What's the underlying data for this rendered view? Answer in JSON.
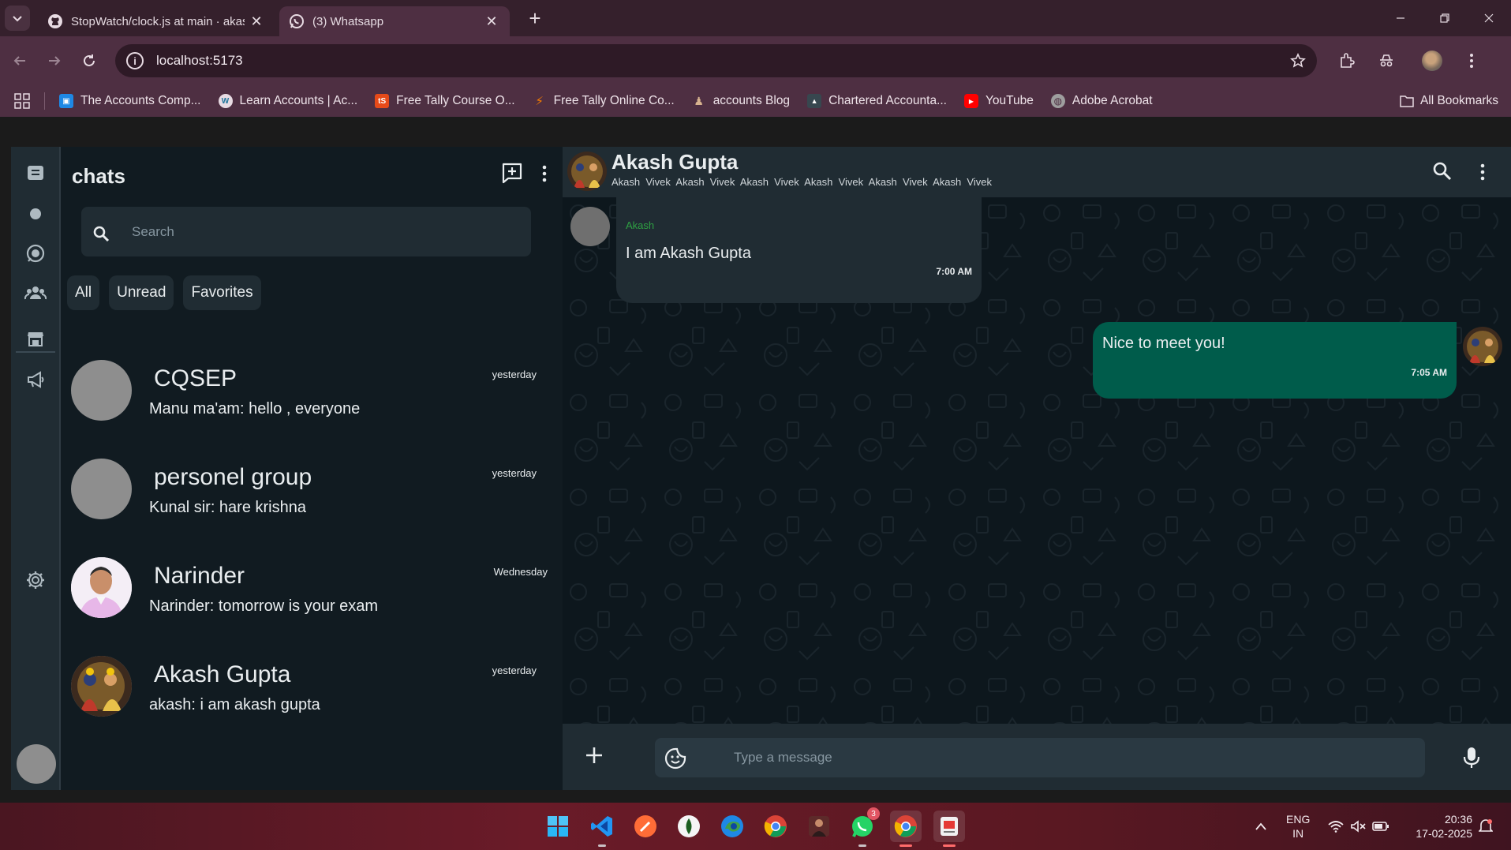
{
  "browser": {
    "tabs": [
      {
        "title": "StopWatch/clock.js at main · akash",
        "favicon": "github-icon",
        "active": false
      },
      {
        "title": "(3) Whatsapp",
        "favicon": "whatsapp-icon",
        "active": true
      }
    ],
    "new_tab_label": "+",
    "url": "localhost:5173",
    "bookmarks": [
      {
        "label": "The Accounts Comp...",
        "icon": "bookmark-favicon",
        "color": "#1e88e5"
      },
      {
        "label": "Learn Accounts | Ac...",
        "icon": "wordpress-icon",
        "color": "#21759b"
      },
      {
        "label": "Free Tally Course O...",
        "icon": "ts-icon",
        "color": "#e64a19"
      },
      {
        "label": "Free Tally Online Co...",
        "icon": "runner-icon",
        "color": "#f57c00"
      },
      {
        "label": "accounts Blog",
        "icon": "person-icon",
        "color": "#6d4c41"
      },
      {
        "label": "Chartered Accounta...",
        "icon": "grad-icon",
        "color": "#37474f"
      },
      {
        "label": "YouTube",
        "icon": "youtube-icon",
        "color": "#ff0000"
      },
      {
        "label": "Adobe Acrobat",
        "icon": "globe-icon",
        "color": "#9e9e9e"
      }
    ],
    "all_bookmarks_label": "All Bookmarks"
  },
  "app": {
    "sidebar_title": "chats",
    "search": {
      "placeholder": "Search"
    },
    "filters": [
      "All",
      "Unread",
      "Favorites"
    ],
    "chats": [
      {
        "name": "CQSEP",
        "time": "yesterday",
        "preview": "Manu ma'am: hello , everyone",
        "avatar": "placeholder"
      },
      {
        "name": "personel group",
        "time": "yesterday",
        "preview": "Kunal sir: hare krishna",
        "avatar": "placeholder"
      },
      {
        "name": "Narinder",
        "time": "Wednesday",
        "preview": "Narinder: tomorrow is your exam",
        "avatar": "photo-man"
      },
      {
        "name": "Akash Gupta",
        "time": "yesterday",
        "preview": "akash: i am akash gupta",
        "avatar": "photo-deity"
      }
    ],
    "conversation": {
      "name": "Akash Gupta",
      "members": "Akash  Vivek  Akash  Vivek  Akash  Vivek  Akash  Vivek  Akash  Vivek  Akash  Vivek",
      "messages": [
        {
          "direction": "in",
          "sender": "Akash",
          "text": "I am Akash Gupta",
          "time": "7:00 AM"
        },
        {
          "direction": "out",
          "text": "Nice to meet you!",
          "time": "7:05 AM"
        }
      ],
      "composer_placeholder": "Type a message"
    }
  },
  "taskbar": {
    "apps": [
      "windows-start",
      "vscode",
      "postman",
      "ledger",
      "edge",
      "chrome",
      "photo-app",
      "whatsapp",
      "chrome-profile",
      "snipping-tool"
    ],
    "whatsapp_badge": "3",
    "lang_line1": "ENG",
    "lang_line2": "IN",
    "time": "20:36",
    "date": "17-02-2025"
  },
  "colors": {
    "rail": "#202c33",
    "panel": "#111b21",
    "bubble_in": "#202c33",
    "bubble_out": "#005c4b",
    "sender_name": "#2ea043"
  }
}
